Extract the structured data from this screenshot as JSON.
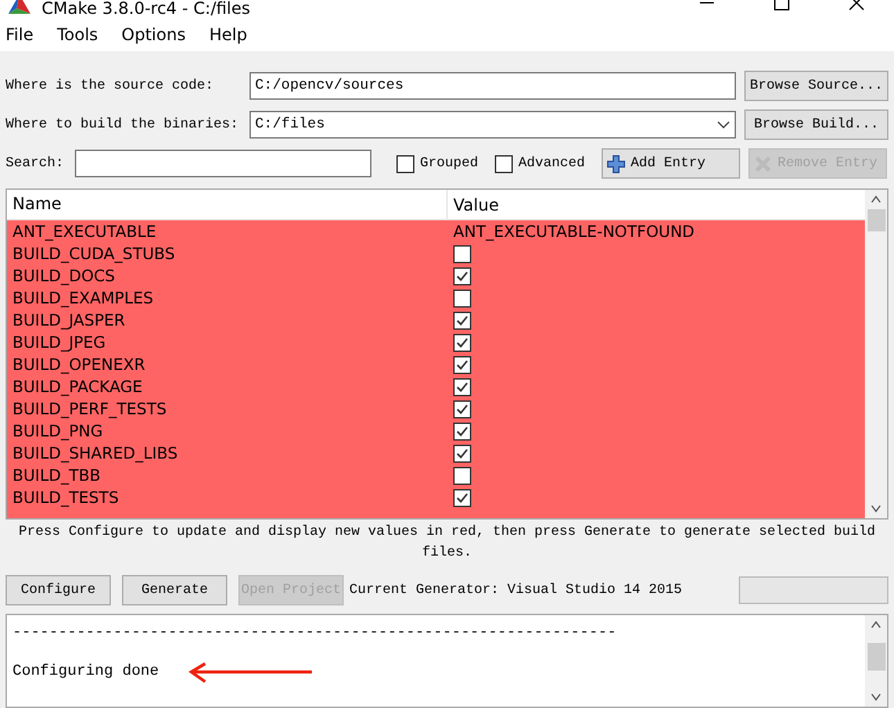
{
  "window": {
    "title": "CMake 3.8.0-rc4 - C:/files"
  },
  "menu": [
    "File",
    "Tools",
    "Options",
    "Help"
  ],
  "source": {
    "label": "Where is the source code:",
    "value": "C:/opencv/sources",
    "button": "Browse Source..."
  },
  "build": {
    "label": "Where to build the binaries:",
    "value": "C:/files",
    "button": "Browse Build..."
  },
  "search": {
    "label": "Search:"
  },
  "options": [
    {
      "label": "Grouped",
      "checked": false
    },
    {
      "label": "Advanced",
      "checked": false
    }
  ],
  "add_entry": {
    "label": "Add Entry",
    "disabled": false
  },
  "remove_entry": {
    "label": "Remove Entry",
    "disabled": true
  },
  "table": {
    "columns": [
      "Name",
      "Value"
    ],
    "rows": [
      {
        "name": "ANT_EXECUTABLE",
        "kind": "path",
        "value": "ANT_EXECUTABLE-NOTFOUND"
      },
      {
        "name": "BUILD_CUDA_STUBS",
        "kind": "bool",
        "checked": false
      },
      {
        "name": "BUILD_DOCS",
        "kind": "bool",
        "checked": true
      },
      {
        "name": "BUILD_EXAMPLES",
        "kind": "bool",
        "checked": false
      },
      {
        "name": "BUILD_JASPER",
        "kind": "bool",
        "checked": true
      },
      {
        "name": "BUILD_JPEG",
        "kind": "bool",
        "checked": true
      },
      {
        "name": "BUILD_OPENEXR",
        "kind": "bool",
        "checked": true
      },
      {
        "name": "BUILD_PACKAGE",
        "kind": "bool",
        "checked": true
      },
      {
        "name": "BUILD_PERF_TESTS",
        "kind": "bool",
        "checked": true
      },
      {
        "name": "BUILD_PNG",
        "kind": "bool",
        "checked": true
      },
      {
        "name": "BUILD_SHARED_LIBS",
        "kind": "bool",
        "checked": true
      },
      {
        "name": "BUILD_TBB",
        "kind": "bool",
        "checked": false
      },
      {
        "name": "BUILD_TESTS",
        "kind": "bool",
        "checked": true
      }
    ]
  },
  "hint": "Press Configure to update and display new values in red, then press Generate to generate selected build files.",
  "actions": [
    {
      "label": "Configure",
      "disabled": false
    },
    {
      "label": "Generate",
      "disabled": false
    },
    {
      "label": "Open Project",
      "disabled": true
    }
  ],
  "generator": "Current Generator: Visual Studio 14 2015",
  "progress": {
    "level": 0
  },
  "log": [
    "------------------------------------------------------------------",
    "Configuring done"
  ]
}
